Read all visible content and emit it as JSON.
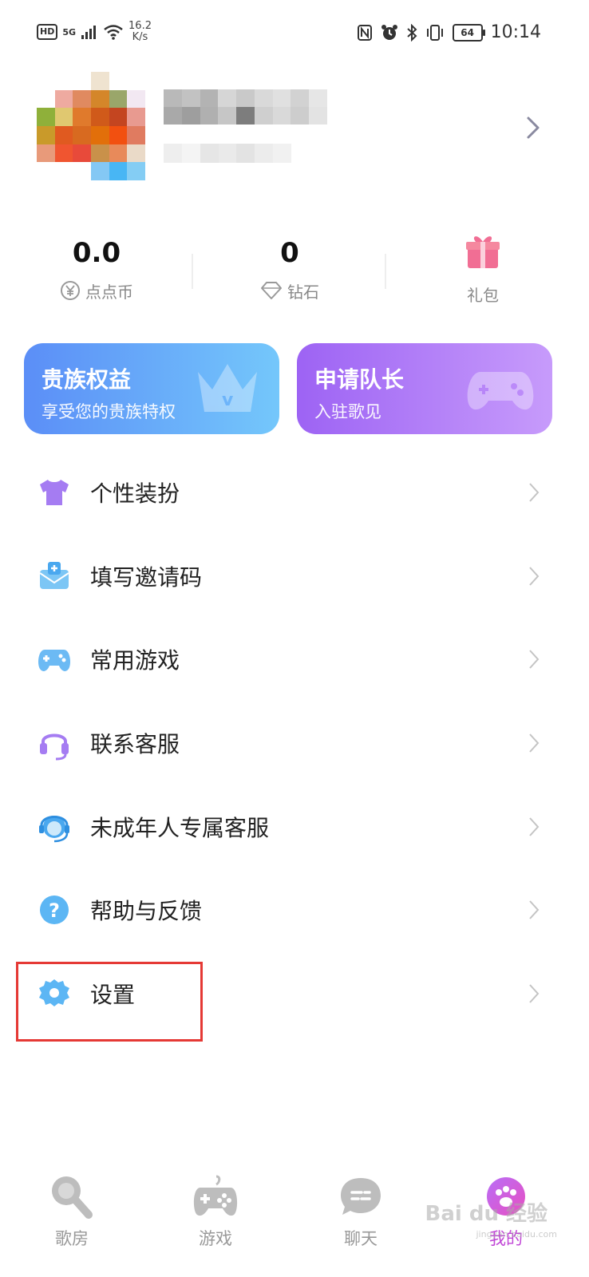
{
  "status_bar": {
    "hd": "HD",
    "network": "5G",
    "speed_value": "16.2",
    "speed_unit": "K/s",
    "battery": "64",
    "time": "10:14"
  },
  "stats": [
    {
      "value": "0.0",
      "label": "点点币",
      "icon": "yen-coin-icon"
    },
    {
      "value": "0",
      "label": "钻石",
      "icon": "diamond-icon"
    },
    {
      "value": "",
      "label": "礼包",
      "icon": "gift-icon"
    }
  ],
  "banners": [
    {
      "title": "贵族权益",
      "subtitle": "享受您的贵族特权",
      "gradient": [
        "#5b8ef7",
        "#74c7fb"
      ]
    },
    {
      "title": "申请队长",
      "subtitle": "入驻歌见",
      "gradient": [
        "#9d63f4",
        "#c79bfb"
      ]
    }
  ],
  "menu": [
    {
      "label": "个性装扮",
      "icon": "tshirt-icon"
    },
    {
      "label": "填写邀请码",
      "icon": "invite-envelope-icon"
    },
    {
      "label": "常用游戏",
      "icon": "gamepad-icon"
    },
    {
      "label": "联系客服",
      "icon": "headset-icon"
    },
    {
      "label": "未成年人专属客服",
      "icon": "minor-support-icon"
    },
    {
      "label": "帮助与反馈",
      "icon": "help-icon"
    },
    {
      "label": "设置",
      "icon": "settings-gear-icon"
    }
  ],
  "tabbar": [
    {
      "label": "歌房",
      "icon": "microphone-icon",
      "active": false
    },
    {
      "label": "游戏",
      "icon": "gamepad-tab-icon",
      "active": false
    },
    {
      "label": "聊天",
      "icon": "chat-icon",
      "active": false
    },
    {
      "label": "我的",
      "icon": "profile-paw-icon",
      "active": true
    }
  ],
  "watermark": {
    "text": "Bai du 经验",
    "sub": "jingyan.baidu.com"
  },
  "colors": {
    "accent": "#c045d6",
    "highlight": "#e53935"
  }
}
